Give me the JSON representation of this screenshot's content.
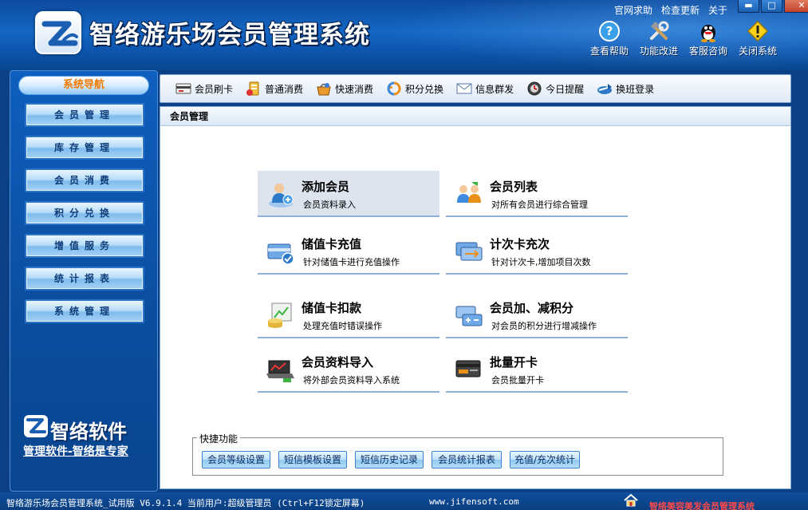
{
  "app": {
    "title": "智络游乐场会员管理系统"
  },
  "top_links": [
    "官网求助",
    "检查更新",
    "关于"
  ],
  "window_controls": {
    "minimize": "▬",
    "maximize": "□",
    "close": "✕"
  },
  "quick_tools": [
    {
      "label": "查看帮助",
      "icon": "help-icon"
    },
    {
      "label": "功能改进",
      "icon": "tools-icon"
    },
    {
      "label": "客服咨询",
      "icon": "qq-icon"
    },
    {
      "label": "关闭系统",
      "icon": "warning-icon"
    }
  ],
  "sidebar": {
    "title": "系统导航",
    "items": [
      "会员管理",
      "库存管理",
      "会员消费",
      "积分兑换",
      "增值服务",
      "统计报表",
      "系统管理"
    ],
    "brand_name": "智络软件",
    "brand_slogan": "管理软件-智络是专家"
  },
  "toolbar": {
    "items": [
      {
        "label": "会员刷卡",
        "icon": "card-swipe-icon"
      },
      {
        "label": "普通消费",
        "icon": "consume-icon"
      },
      {
        "label": "快速消费",
        "icon": "fast-consume-icon"
      },
      {
        "label": "积分兑换",
        "icon": "exchange-icon"
      },
      {
        "label": "信息群发",
        "icon": "message-icon"
      },
      {
        "label": "今日提醒",
        "icon": "reminder-icon"
      },
      {
        "label": "换班登录",
        "icon": "shift-login-icon"
      }
    ]
  },
  "main": {
    "section_title": "会员管理",
    "functions": [
      {
        "title": "添加会员",
        "desc": "会员资料录入",
        "icon": "add-member-icon",
        "selected": true
      },
      {
        "title": "会员列表",
        "desc": "对所有会员进行综合管理",
        "icon": "member-list-icon",
        "selected": false
      },
      {
        "title": "储值卡充值",
        "desc": "针对储值卡进行充值操作",
        "icon": "stored-card-recharge-icon",
        "selected": false
      },
      {
        "title": "计次卡充次",
        "desc": "针对计次卡,增加项目次数",
        "icon": "count-card-recharge-icon",
        "selected": false
      },
      {
        "title": "储值卡扣款",
        "desc": "处理充值时错误操作",
        "icon": "stored-card-deduct-icon",
        "selected": false
      },
      {
        "title": "会员加、减积分",
        "desc": "对会员的积分进行增减操作",
        "icon": "points-adjust-icon",
        "selected": false
      },
      {
        "title": "会员资料导入",
        "desc": "将外部会员资料导入系统",
        "icon": "import-icon",
        "selected": false
      },
      {
        "title": "批量开卡",
        "desc": "会员批量开卡",
        "icon": "batch-card-icon",
        "selected": false
      }
    ],
    "quick_functions": {
      "legend": "快捷功能",
      "buttons": [
        "会员等级设置",
        "短信模板设置",
        "短信历史记录",
        "会员统计报表",
        "充值/充次统计"
      ]
    }
  },
  "statusbar": {
    "text": "智络游乐场会员管理系统_试用版 V6.9.1.4 当前用户:超级管理员 (Ctrl+F12锁定屏幕)",
    "url": "www.jifensoft.com",
    "scroll_text": "智络美容美发会员管理系统"
  },
  "colors": {
    "frame_blue": "#0b3f86",
    "nav_title_orange": "#f07a00",
    "scroll_text_red": "#ff4a4a"
  }
}
